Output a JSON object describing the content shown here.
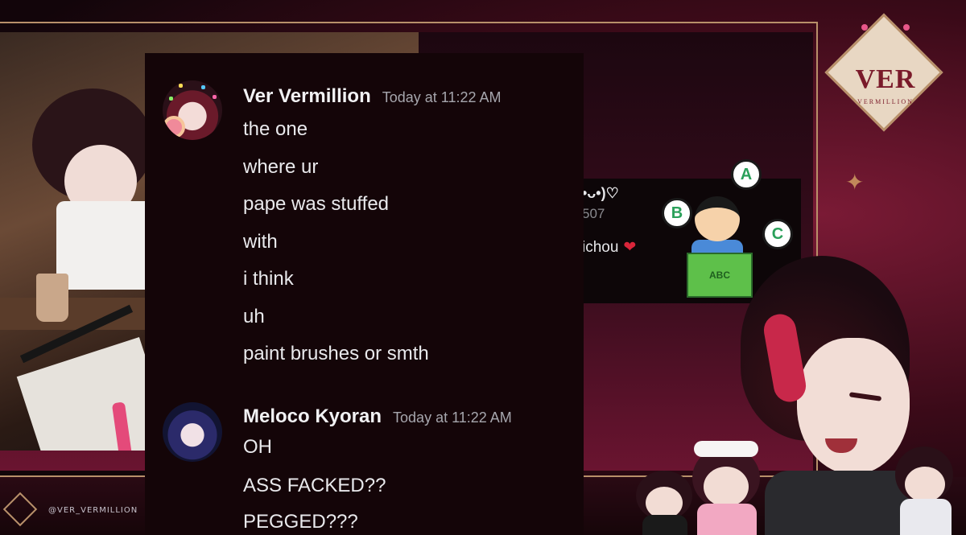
{
  "overlay": {
    "logo_text": "VER",
    "logo_subtitle": "VERMILLION",
    "social_handle": "@VER_VERMILLION"
  },
  "chat": {
    "messages": [
      {
        "username": "Ver Vermillion",
        "timestamp": "Today at 11:22 AM",
        "lines": [
          "the one",
          "where ur",
          "pape was stuffed",
          "with",
          "i think",
          "uh",
          "paint brushes or smth"
        ]
      },
      {
        "username": "Meloco Kyoran",
        "timestamp": "Today at 11:22 AM",
        "lines": [
          "OH",
          "ASS FACKED??",
          "PEGGED???"
        ]
      }
    ]
  },
  "secondary_clip": {
    "name_fragment": "•ᴗ•)♡",
    "id_fragment": "507",
    "message_fragment": "ichou",
    "heart": "❤",
    "bubbles": [
      "A",
      "B",
      "C"
    ],
    "book_label": "ABC"
  },
  "colors": {
    "accent_gold": "#b8906a",
    "accent_crimson": "#c8284a",
    "chat_bg": "#140508"
  }
}
